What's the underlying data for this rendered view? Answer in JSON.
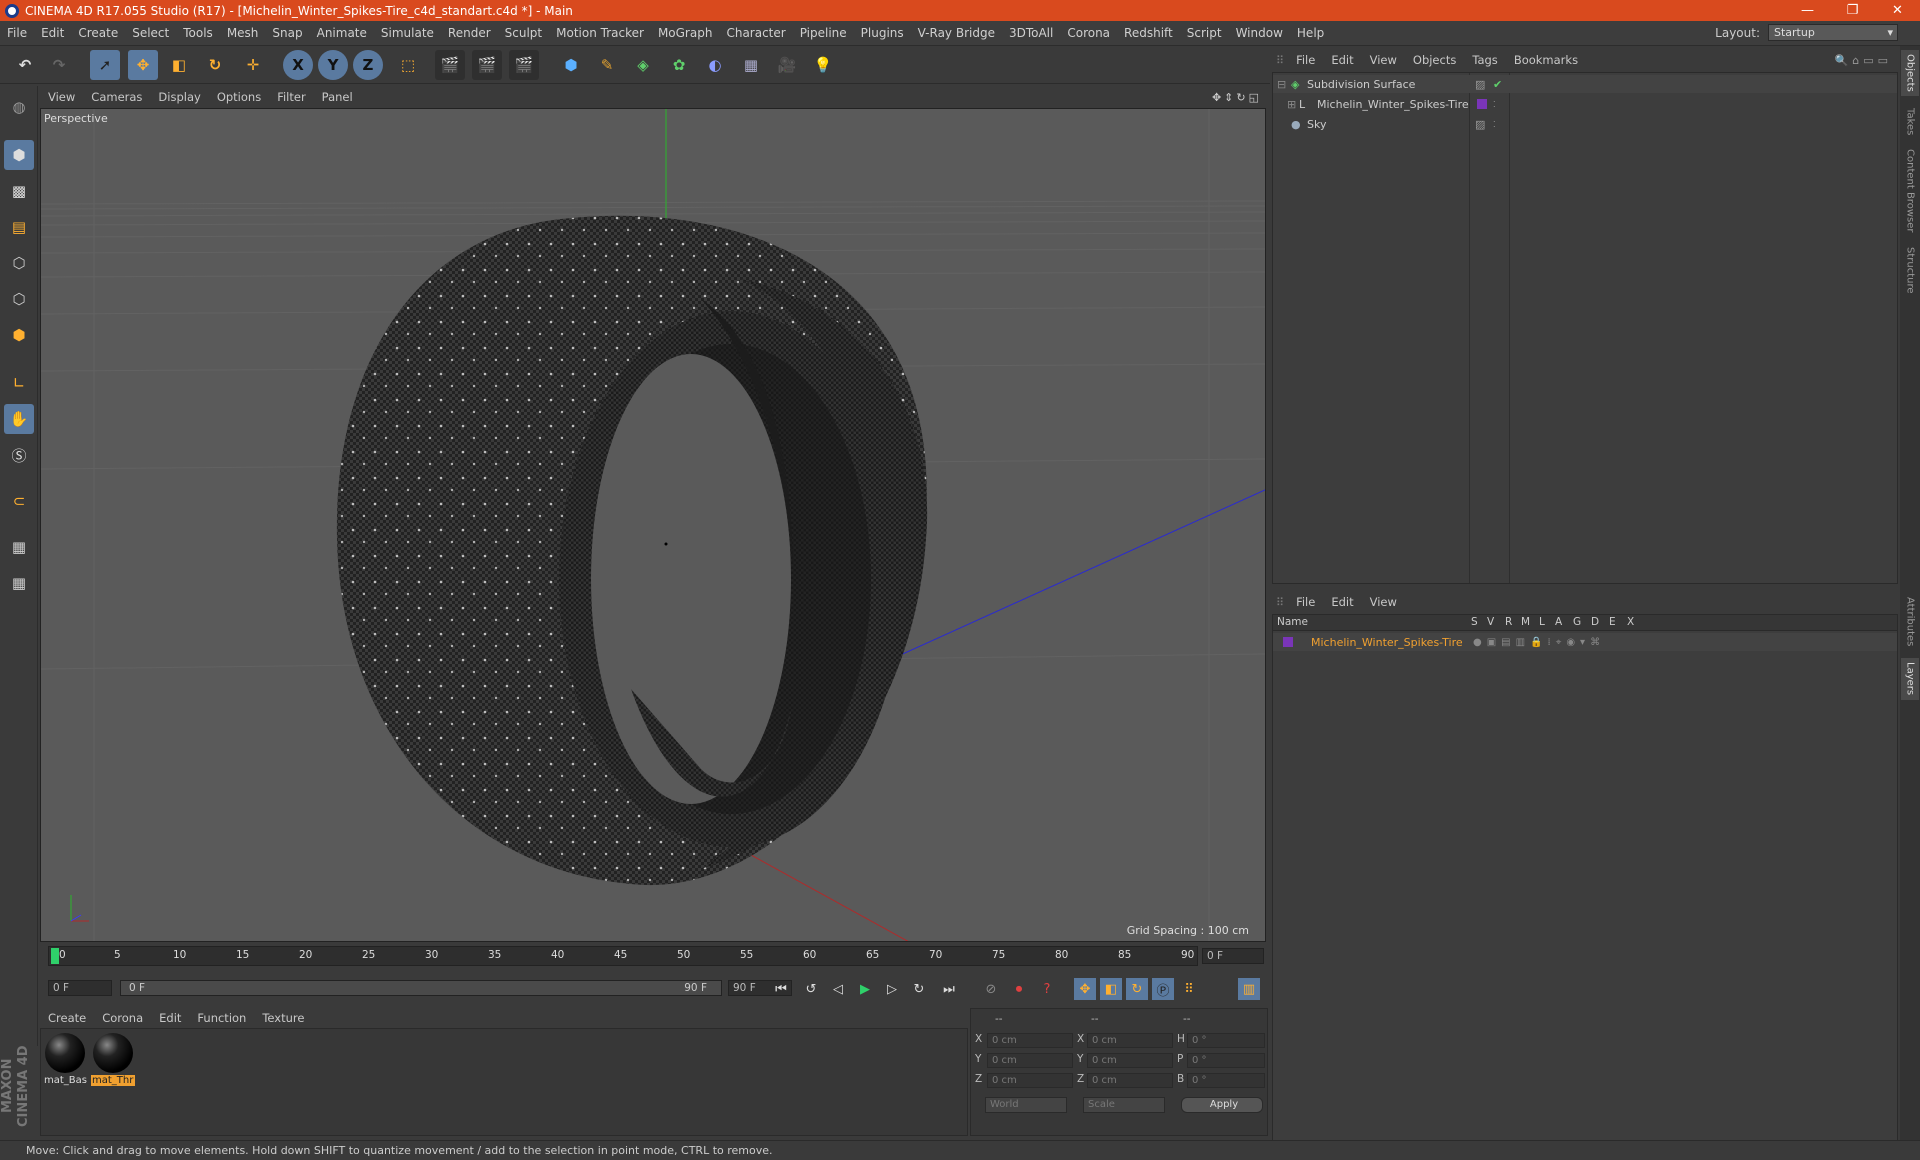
{
  "window": {
    "title": "CINEMA 4D R17.055 Studio (R17) - [Michelin_Winter_Spikes-Tire_c4d_standart.c4d *] - Main",
    "controls": [
      "—",
      "❐",
      "✕"
    ]
  },
  "menubar": {
    "items": [
      "File",
      "Edit",
      "Create",
      "Select",
      "Tools",
      "Mesh",
      "Snap",
      "Animate",
      "Simulate",
      "Render",
      "Sculpt",
      "Motion Tracker",
      "MoGraph",
      "Character",
      "Pipeline",
      "Plugins",
      "V-Ray Bridge",
      "3DToAll",
      "Corona",
      "Redshift",
      "Script",
      "Window",
      "Help"
    ],
    "layout_label": "Layout:",
    "layout_value": "Startup"
  },
  "toolbar": {
    "axis_x": "X",
    "axis_y": "Y",
    "axis_z": "Z"
  },
  "viewport": {
    "menu": [
      "View",
      "Cameras",
      "Display",
      "Options",
      "Filter",
      "Panel"
    ],
    "camera_label": "Perspective",
    "grid_spacing": "Grid Spacing : 100 cm"
  },
  "timeline": {
    "ticks": [
      "0",
      "5",
      "10",
      "15",
      "20",
      "25",
      "30",
      "35",
      "40",
      "45",
      "50",
      "55",
      "60",
      "65",
      "70",
      "75",
      "80",
      "85",
      "90"
    ],
    "current_frame": "0 F",
    "start_field": "0 F",
    "range_start": "0 F",
    "range_end": "90 F",
    "end_field": "90 F"
  },
  "material_manager": {
    "menu": [
      "Create",
      "Corona",
      "Edit",
      "Function",
      "Texture"
    ],
    "materials": [
      {
        "label": "mat_Bas",
        "selected": false
      },
      {
        "label": "mat_Thr",
        "selected": true
      }
    ]
  },
  "coordinates": {
    "headers": [
      "--",
      "--",
      "--"
    ],
    "rows": [
      {
        "l1": "X",
        "v1": "0 cm",
        "l2": "X",
        "v2": "0 cm",
        "l3": "H",
        "v3": "0 °"
      },
      {
        "l1": "Y",
        "v1": "0 cm",
        "l2": "Y",
        "v2": "0 cm",
        "l3": "P",
        "v3": "0 °"
      },
      {
        "l1": "Z",
        "v1": "0 cm",
        "l2": "Z",
        "v2": "0 cm",
        "l3": "B",
        "v3": "0 °"
      }
    ],
    "space": "World",
    "mode": "Scale",
    "apply": "Apply"
  },
  "object_manager": {
    "menu": [
      "File",
      "Edit",
      "View",
      "Objects",
      "Tags",
      "Bookmarks"
    ],
    "objects": [
      {
        "name": "Subdivision Surface",
        "indent": 0
      },
      {
        "name": "Michelin_Winter_Spikes-Tire",
        "indent": 1
      },
      {
        "name": "Sky",
        "indent": 0
      }
    ]
  },
  "layer_manager": {
    "menu": [
      "File",
      "Edit",
      "View"
    ],
    "columns": [
      "Name",
      "S",
      "V",
      "R",
      "M",
      "L",
      "A",
      "G",
      "D",
      "E",
      "X"
    ],
    "layers": [
      {
        "name": "Michelin_Winter_Spikes-Tire",
        "color": "#7a35b8"
      }
    ]
  },
  "right_tabs": [
    "Objects",
    "Takes",
    "Content Browser",
    "Structure",
    "Attributes",
    "Layers"
  ],
  "branding": "MAXON CINEMA 4D",
  "status": "Move: Click and drag to move elements. Hold down SHIFT to quantize movement / add to the selection in point mode, CTRL to remove.",
  "colors": {
    "title_bar": "#d94a1e",
    "accent": "#5a7aa0",
    "layer_text": "#f0a030"
  }
}
